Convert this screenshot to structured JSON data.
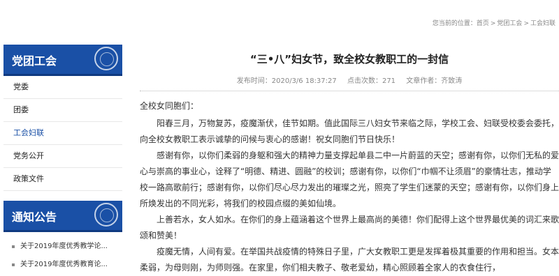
{
  "breadcrumb": {
    "prefix": "您当前的位置：",
    "items": [
      "首页",
      "党团工会",
      "工会妇联"
    ],
    "separator": ">"
  },
  "sidebar": {
    "section_title": "党团工会",
    "items": [
      {
        "label": "党委"
      },
      {
        "label": "团委"
      },
      {
        "label": "工会妇联"
      },
      {
        "label": "党务公开"
      },
      {
        "label": "政策文件"
      }
    ],
    "active_index": 2,
    "accent_color": "#1a50a6"
  },
  "notice": {
    "section_title": "通知公告",
    "items": [
      {
        "label": "关于2019年度优秀教学论..."
      },
      {
        "label": "关于2019年度优秀教育论..."
      }
    ]
  },
  "article": {
    "title": "“三•八”妇女节，致全校女教职工的一封信",
    "publish_time": "发布时间：2020/3/6 18:37:27",
    "clicks": "点击次数：271",
    "author": "文章作者：齐致涛",
    "greeting": "全校女同胞们：",
    "paragraphs": [
      "阳春三月，万物复苏，疫魔渐伏，佳节如期。值此国际三八妇女节来临之际，学校工会、妇联受校委会委托，向全校女教职工表示诚挚的问候与衷心的感谢！祝女同胞们节日快乐！",
      "感谢有你，以你们柔弱的身躯和强大的精神力量支撑起单县二中一片蔚蓝的天空；感谢有你，以你们无私的爱心与崇高的事业心，诠释了“明德、精进、圆融”的校训；感谢有你，以你们“巾帼不让须眉”的豪情壮志，推动学校一路高歌前行；感谢有你，以你们尽心尽力发出的璀璨之光，照亮了学生们迷蒙的天空；感谢有你，以你们身上所焕发出的不同光彩，将我们的校园点缀的美如仙境。",
      "上善若水，女人如水。在你们的身上蕴涵着这个世界上最高尚的美德！你们配得上这个世界最优美的词汇来歌颂和赞美！",
      "疫魔无情，人间有爱。在举国共战疫情的特殊日子里，广大女教职工更是发挥着极其重要的作用和担当。女本柔弱，为母则刚，为师则强。在家里，你们相夫教子、敬老爱幼，精心照顾着全家人的衣食住行，"
    ]
  }
}
